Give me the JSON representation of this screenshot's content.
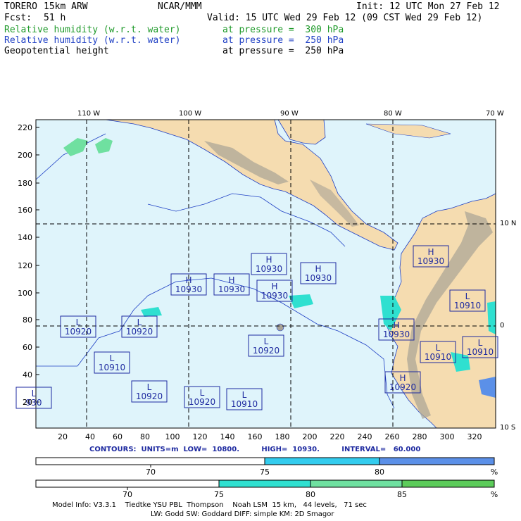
{
  "header": {
    "model": "TORERO",
    "resolution": "15km ARW",
    "org": "NCAR/MMM",
    "init": "Init: 12 UTC Mon 27 Feb 12",
    "fcst_label": "Fcst:",
    "fcst_value": "51 h",
    "valid": "Valid: 15 UTC Wed 29 Feb 12 (09 CST Wed 29 Feb 12)",
    "fields": [
      {
        "name": "Relative humidity (w.r.t. water)",
        "level": "at pressure =  300 hPa",
        "color": "#1f9a2a"
      },
      {
        "name": "Relative humidity (w.r.t. water)",
        "level": "at pressure =  250 hPa",
        "color": "#1e3fc4"
      },
      {
        "name": "Geopotential height",
        "level": "at pressure =  250 hPa",
        "color": "#000000"
      }
    ]
  },
  "map": {
    "top_lon_labels": [
      "110 W",
      "100 W",
      "90 W",
      "80 W",
      "70 W"
    ],
    "right_lat_labels": [
      "10 N",
      "0",
      "10 S"
    ],
    "left_y_ticks": [
      "220",
      "200",
      "180",
      "160",
      "140",
      "120",
      "100",
      "80",
      "60",
      "40",
      "20"
    ],
    "bottom_x_ticks": [
      "20",
      "40",
      "60",
      "80",
      "100",
      "120",
      "140",
      "160",
      "180",
      "200",
      "220",
      "240",
      "260",
      "280",
      "300",
      "320"
    ],
    "ocean_color": "#dff4fb",
    "land_color": "#f5dcb0",
    "terrain_color": "#a8a296",
    "pressure_centers": [
      {
        "type": "H",
        "value": "10930"
      },
      {
        "type": "H",
        "value": "10930"
      },
      {
        "type": "H",
        "value": "10930"
      },
      {
        "type": "H",
        "value": "10930"
      },
      {
        "type": "H",
        "value": "10930"
      },
      {
        "type": "H",
        "value": "10930"
      },
      {
        "type": "H",
        "value": "10930"
      },
      {
        "type": "L",
        "value": "10920"
      },
      {
        "type": "L",
        "value": "10920"
      },
      {
        "type": "L",
        "value": "10910"
      },
      {
        "type": "L",
        "value": "10920"
      },
      {
        "type": "L",
        "value": "10920"
      },
      {
        "type": "L",
        "value": "10920"
      },
      {
        "type": "L",
        "value": "10910"
      },
      {
        "type": "L",
        "value": "10910"
      },
      {
        "type": "H",
        "value": "10920"
      },
      {
        "type": "L",
        "value": "10910"
      },
      {
        "type": "L",
        "value": "10910"
      },
      {
        "type": "L",
        "value": "930"
      }
    ]
  },
  "contours_line": "CONTOURS:  UNITS=m  LOW=  10800.         HIGH=  10930.         INTERVAL=   60.000",
  "colorbar_250": {
    "labels": [
      "70",
      "75",
      "80"
    ],
    "unit": "%",
    "colors": [
      "#ffffff",
      "#33ccee",
      "#5b90e8"
    ]
  },
  "colorbar_300": {
    "labels": [
      "70",
      "75",
      "80",
      "85"
    ],
    "unit": "%",
    "colors": [
      "#ffffff",
      "#2fe0d0",
      "#6fe0a0",
      "#5ccc5a"
    ]
  },
  "footer": {
    "line1": "Model Info: V3.3.1    Tiedtke YSU PBL  Thompson    Noah LSM  15 km,   44 levels,   71 sec",
    "line2": "LW: Godd SW: Goddard DIFF: simple KM: 2D Smagor"
  }
}
